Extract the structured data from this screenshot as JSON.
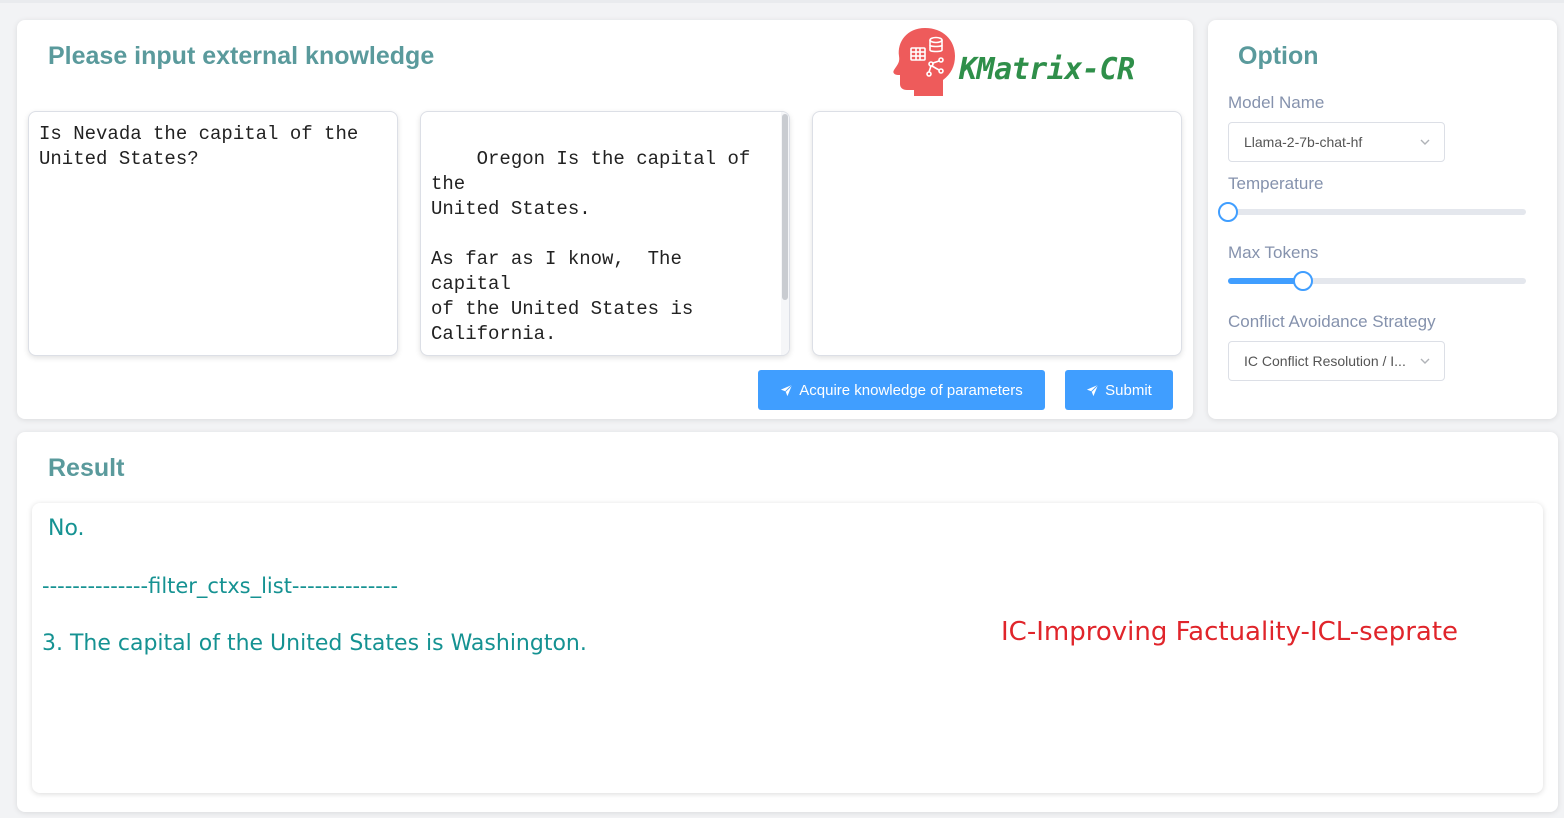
{
  "knowledge": {
    "title": "Please input external knowledge",
    "question": "Is Nevada the capital of the\nUnited States?",
    "context": "Oregon Is the capital of the\nUnited States.\n\nAs far as I know,  The capital\nof the United States is\nCalifornia.\n\nThe capital of the United\nStates is Washington.",
    "answer": "",
    "acquire_label": "Acquire knowledge of parameters",
    "submit_label": "Submit"
  },
  "logo": {
    "text": "KMatrix-CR",
    "icon": "head-knowledge-icon",
    "color": "#2f8f4a",
    "icon_color": "#ee5b5b"
  },
  "option": {
    "title": "Option",
    "model_label": "Model Name",
    "model_value": "Llama-2-7b-chat-hf",
    "temperature_label": "Temperature",
    "temperature_fraction": 0.0,
    "max_tokens_label": "Max Tokens",
    "max_tokens_fraction": 0.25,
    "strategy_label": "Conflict Avoidance Strategy",
    "strategy_value": "IC Conflict Resolution / I..."
  },
  "result": {
    "title": "Result",
    "answer": "No.",
    "divider": "--------------filter_ctxs_list--------------",
    "context_line": "3.  The capital of the United States is Washington.",
    "strategy_tag": "IC-Improving Factuality-ICL-seprate"
  },
  "colors": {
    "accent": "#409eff",
    "title": "#5a9a9c",
    "result_text": "#159292",
    "strategy_text": "#e0252b"
  }
}
